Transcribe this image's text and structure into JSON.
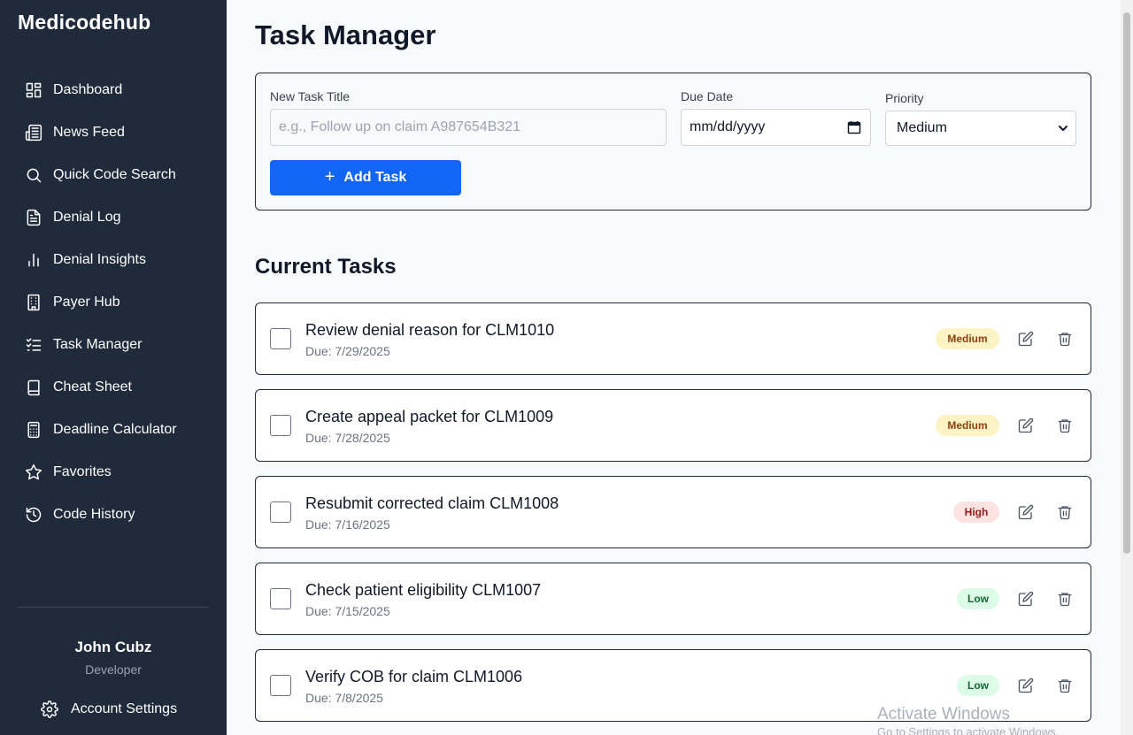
{
  "sidebar": {
    "brand": "Medicodehub",
    "items": [
      {
        "label": "Dashboard",
        "icon": "dashboard-icon"
      },
      {
        "label": "News Feed",
        "icon": "newspaper-icon"
      },
      {
        "label": "Quick Code Search",
        "icon": "search-icon"
      },
      {
        "label": "Denial Log",
        "icon": "document-icon"
      },
      {
        "label": "Denial Insights",
        "icon": "bar-chart-icon"
      },
      {
        "label": "Payer Hub",
        "icon": "building-icon"
      },
      {
        "label": "Task Manager",
        "icon": "checklist-icon"
      },
      {
        "label": "Cheat Sheet",
        "icon": "book-icon"
      },
      {
        "label": "Deadline Calculator",
        "icon": "calculator-icon"
      },
      {
        "label": "Favorites",
        "icon": "star-icon"
      },
      {
        "label": "Code History",
        "icon": "history-icon"
      }
    ],
    "user": {
      "name": "John Cubz",
      "role": "Developer"
    },
    "account_label": "Account Settings"
  },
  "main": {
    "title": "Task Manager",
    "form": {
      "title_label": "New Task Title",
      "title_placeholder": "e.g., Follow up on claim A987654B321",
      "due_label": "Due Date",
      "due_value": "mm/dd/yyyy",
      "priority_label": "Priority",
      "priority_value": "Medium",
      "add_label": "Add Task"
    },
    "section_title": "Current Tasks",
    "tasks": [
      {
        "title": "Review denial reason for CLM1010",
        "due": "Due: 7/29/2025",
        "priority": "Medium"
      },
      {
        "title": "Create appeal packet for CLM1009",
        "due": "Due: 7/28/2025",
        "priority": "Medium"
      },
      {
        "title": "Resubmit corrected claim CLM1008",
        "due": "Due: 7/16/2025",
        "priority": "High"
      },
      {
        "title": "Check patient eligibility CLM1007",
        "due": "Due: 7/15/2025",
        "priority": "Low"
      },
      {
        "title": "Verify COB for claim CLM1006",
        "due": "Due: 7/8/2025",
        "priority": "Low"
      }
    ]
  },
  "watermark": {
    "line1": "Activate Windows",
    "line2": "Go to Settings to activate Windows."
  },
  "colors": {
    "sidebar_bg": "#1f2a3a",
    "accent": "#1366f5"
  }
}
